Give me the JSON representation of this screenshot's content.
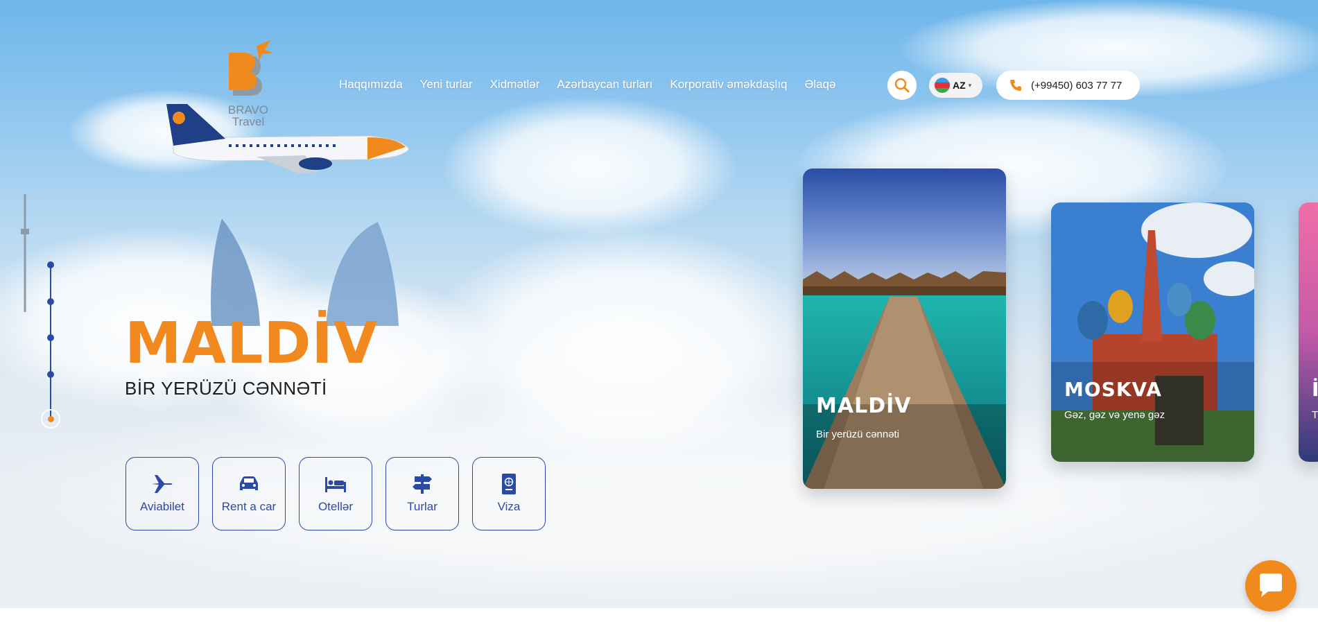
{
  "brand": {
    "logo_line1": "BRAVO",
    "logo_line2": "Travel",
    "accent": "#f08a1c",
    "primary": "#2b4aa5"
  },
  "nav": {
    "items": [
      {
        "label": "Haqqımızda"
      },
      {
        "label": "Yeni turlar"
      },
      {
        "label": "Xidmətlər"
      },
      {
        "label": "Azərbaycan turları"
      },
      {
        "label": "Korporativ əməkdaşlıq"
      },
      {
        "label": "Əlaqə"
      }
    ],
    "search_icon": "search-icon",
    "language": "AZ",
    "phone": "(+99450) 603 77 77"
  },
  "hero": {
    "title": "MALDİV",
    "subtitle": "BİR YERÜZÜ CƏNNƏTİ",
    "slides_total": 5,
    "active_slide": 5
  },
  "services": [
    {
      "label": "Aviabilet",
      "icon": "plane-icon"
    },
    {
      "label": "Rent a car",
      "icon": "car-icon"
    },
    {
      "label": "Otellər",
      "icon": "bed-icon"
    },
    {
      "label": "Turlar",
      "icon": "signpost-icon"
    },
    {
      "label": "Viza",
      "icon": "passport-icon"
    }
  ],
  "cards": [
    {
      "title": "MALDİV",
      "subtitle": "Bir yerüzü cənnəti"
    },
    {
      "title": "MOSKVA",
      "subtitle": "Gəz, gəz və yenə gəz"
    },
    {
      "title": "İ",
      "subtitle": "T"
    }
  ],
  "chat": {
    "icon": "chat-bubble-icon"
  }
}
